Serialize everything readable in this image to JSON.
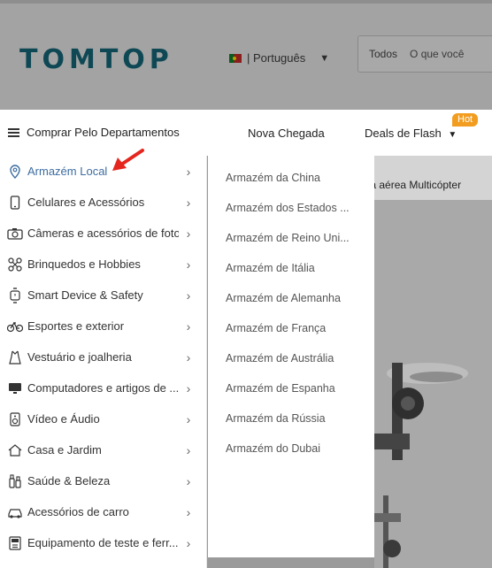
{
  "header": {
    "logo": "TOMTOP",
    "language": "| Português",
    "language_caret": "▼",
    "search_category": "Todos",
    "search_placeholder": "O que você"
  },
  "navbar": {
    "departments_label": "Comprar Pelo Departamentos",
    "new_arrivals": "Nova Chegada",
    "deals": "Deals de Flash",
    "deals_caret": "▼",
    "hot_badge": "Hot"
  },
  "content": {
    "banner_text": "grafia aérea Multicópter"
  },
  "menu": {
    "items": [
      {
        "label": "Armazém Local",
        "icon": "location-pin-icon"
      },
      {
        "label": "Celulares e Acessórios",
        "icon": "phone-icon"
      },
      {
        "label": "Câmeras e acessórios de fotos",
        "icon": "camera-icon"
      },
      {
        "label": "Brinquedos e Hobbies",
        "icon": "drone-icon"
      },
      {
        "label": "Smart Device & Safety",
        "icon": "smartwatch-icon"
      },
      {
        "label": "Esportes e exterior",
        "icon": "bicycle-icon"
      },
      {
        "label": "Vestuário e joalheria",
        "icon": "clothing-icon"
      },
      {
        "label": "Computadores e artigos de ...",
        "icon": "monitor-icon"
      },
      {
        "label": "Vídeo e Áudio",
        "icon": "speaker-icon"
      },
      {
        "label": "Casa e Jardim",
        "icon": "home-icon"
      },
      {
        "label": "Saúde & Beleza",
        "icon": "beauty-icon"
      },
      {
        "label": "Acessórios de carro",
        "icon": "car-icon"
      },
      {
        "label": "Equipamento de teste e ferr...",
        "icon": "meter-icon"
      }
    ]
  },
  "submenu": {
    "items": [
      "Armazém da China",
      "Armazém dos Estados ...",
      "Armazém de Reino Uni...",
      "Armazém de Itália",
      "Armazém de Alemanha",
      "Armazém de França",
      "Armazém de Austrália",
      "Armazém de Espanha",
      "Armazém da Rússia",
      "Armazém do Dubai"
    ]
  },
  "colors": {
    "accent": "#3d6da0",
    "hot": "#f29d1f",
    "logo": "#0f4855",
    "arrow": "#e5261f"
  }
}
